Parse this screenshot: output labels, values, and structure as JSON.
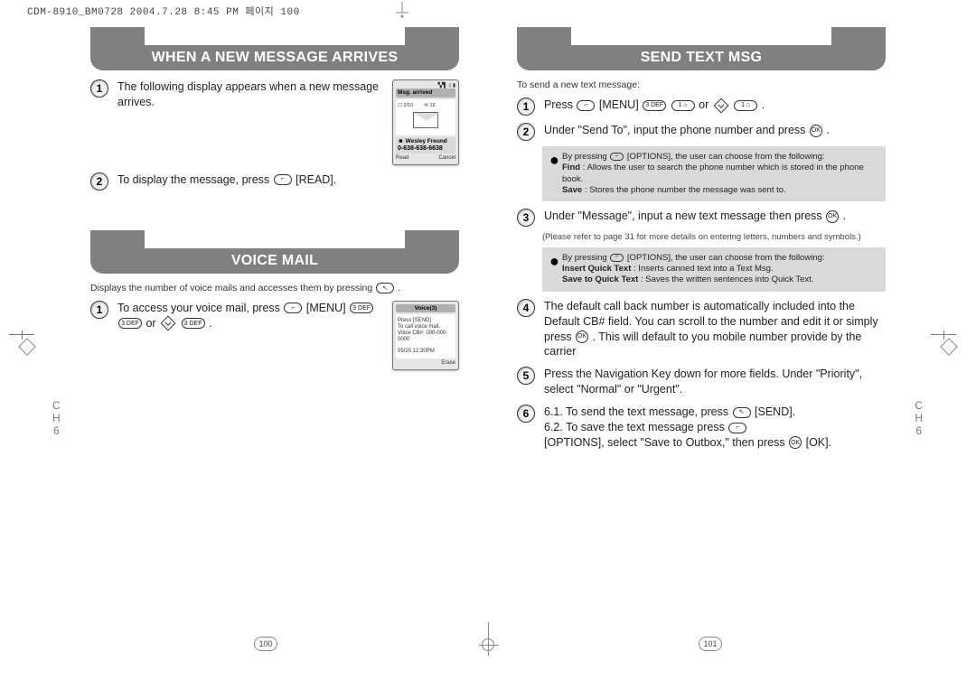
{
  "print_header": "CDM-8910_BM0728  2004.7.28 8:45 PM  페이지 100",
  "side_ch_label1": "C",
  "side_ch_label2": "H",
  "side_ch_num": "6",
  "left_page": {
    "section1_title": "WHEN A NEW MESSAGE ARRIVES",
    "step1": "The following display appears when a new message arrives.",
    "screen1_title": "Msg. arrived",
    "screen1_name": "Wesley Freund",
    "screen1_number": "0-638-638-6638",
    "screen1_bot_left": "Read",
    "screen1_bot_right": "Cancel",
    "step2_a": "To display the message, press ",
    "step2_b": " [READ].",
    "section2_title": "VOICE MAIL",
    "section2_intro": "Displays the number of voice mails and accesses them by pressing ",
    "vm_step1_a": "To access your voice mail, press ",
    "vm_step1_b": " [MENU] ",
    "vm_step1_c": " or ",
    "vm_step1_d": " .",
    "key_3": "3 DEF",
    "screen2_title": "Voice(3)",
    "screen2_l1": "Press [SEND]",
    "screen2_l2": "To call voice mail.",
    "screen2_l3": "Voice CB#: 000-000-0000",
    "screen2_time": "05/20 12:30PM",
    "screen2_bot": "Erase",
    "page_num": "100"
  },
  "right_page": {
    "section_title": "SEND TEXT MSG",
    "intro": "To send a new text message:",
    "step1_a": "Press ",
    "step1_b": " [MENU] ",
    "step1_c": " or ",
    "step1_d": " .",
    "key_3": "3 DEF",
    "key_1": "1 ⌂",
    "step2": "Under \"Send To\", input the phone number and press ",
    "step2_end": " .",
    "ok_label": "OK",
    "note1_lead": "By pressing ",
    "note1_lead2": " [OPTIONS], the user can choose from the following:",
    "note1_find_label": "Find",
    "note1_find_text": " : Allows the user to search the phone number which is stored in the phone book.",
    "note1_save_label": "Save",
    "note1_save_text": " : Stores the phone number the message was sent to.",
    "step3": "Under \"Message\", input a new text message then press ",
    "step3_end": " .",
    "step3_sub": "(Please refer to page 31 for more details on entering letters, numbers and symbols.)",
    "note2_lead": "By pressing ",
    "note2_lead2": " [OPTIONS], the user can choose from the following:",
    "note2_iqt_label": "Insert Quick Text",
    "note2_iqt_text": ": Inserts canned text into a Text Msg.",
    "note2_sqt_label": "Save to Quick Text",
    "note2_sqt_text": ": Saves the written sentences into Quick Text.",
    "step4": "The default call back number is automatically included into the Default CB# field. You can scroll to the number and edit it or simply press ",
    "step4_end": " . This will default to you mobile number provide by the carrier",
    "step5": "Press the Navigation Key down for more fields. Under \"Priority\", select \"Normal\" or \"Urgent\".",
    "step6_1": "6.1. To send the text message, press ",
    "step6_1b": " [SEND].",
    "step6_2": "6.2. To save the text message press ",
    "step6_2b": " [OPTIONS], select \"Save to Outbox,\" then press ",
    "step6_2c": " [OK].",
    "page_num": "101"
  }
}
